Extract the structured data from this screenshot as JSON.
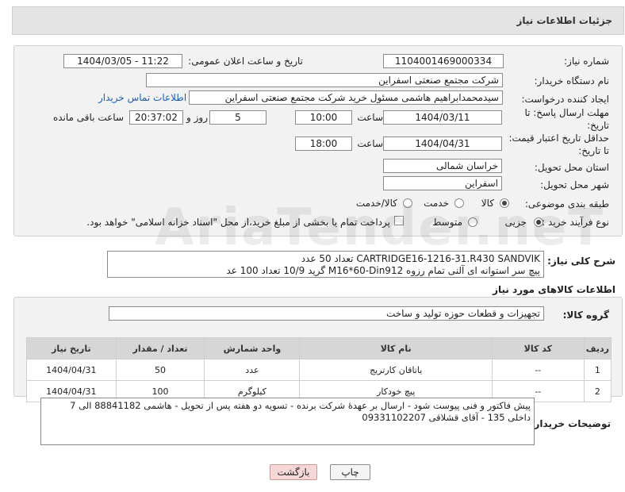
{
  "header": {
    "title": "جزئیات اطلاعات نیاز"
  },
  "form": {
    "need_number_label": "شماره نیاز:",
    "need_number": "1104001469000334",
    "announce_datetime_label": "تاریخ و ساعت اعلان عمومی:",
    "announce_datetime": "1404/03/05 - 11:22",
    "buyer_org_label": "نام دستگاه خریدار:",
    "buyer_org": "شرکت مجتمع صنعتی اسفراین",
    "requester_label": "ایجاد کننده درخواست:",
    "requester": "سیدمحمدابراهیم هاشمی مسئول خرید شرکت مجتمع صنعتی اسفراین",
    "contact_link": "اطلاعات تماس خریدار",
    "reply_deadline_label": "مهلت ارسال پاسخ: تا تاریخ:",
    "reply_deadline_line1": "مهلت ارسال پاسخ: تا",
    "reply_deadline_line2": "تاریخ:",
    "reply_date": "1404/03/11",
    "time_label": "ساعت",
    "reply_time": "10:00",
    "days_value": "5",
    "days_label": "روز و",
    "remaining_time": "20:37:02",
    "remaining_label": "ساعت باقی مانده",
    "price_valid_line1": "حداقل تاریخ اعتبار قیمت:",
    "price_valid_line2": "تا تاریخ:",
    "price_valid_date": "1404/04/31",
    "price_valid_time": "18:00",
    "province_label": "استان محل تحویل:",
    "province": "خراسان شمالی",
    "city_label": "شهر محل تحویل:",
    "city": "اسفراین",
    "category_label": "طبقه بندی موضوعی:",
    "category_options": [
      "کالا",
      "خدمت",
      "کالا/خدمت"
    ],
    "category_selected": "کالا",
    "process_label": "نوع فرآیند خرید :",
    "process_options": [
      "جزیی",
      "متوسط"
    ],
    "process_selected": "جزیی",
    "payment_note": "پرداخت تمام یا بخشی از مبلغ خرید،از محل \"اسناد خزانه اسلامی\" خواهد بود."
  },
  "description": {
    "label": "شرح کلی نیاز:",
    "line1": "CARTRIDGE16-1216-31.R430 SANDVIK تعداد 50 عدد",
    "line2": "پیچ سر استوانه ای آلنی تمام رزوه M16*60-Din912 گرید 10/9 تعداد 100 عد"
  },
  "goods": {
    "section_title": "اطلاعات کالاهای مورد نیاز",
    "group_label": "گروه کالا:",
    "group_value": "تجهیزات و قطعات حوزه تولید و ساخت",
    "columns": [
      "ردیف",
      "کد کالا",
      "نام کالا",
      "واحد شمارش",
      "تعداد / مقدار",
      "تاریخ نیاز"
    ],
    "rows": [
      {
        "row": "1",
        "code": "--",
        "name": "یاتاقان کارتریج",
        "unit": "عدد",
        "qty": "50",
        "date": "1404/04/31"
      },
      {
        "row": "2",
        "code": "--",
        "name": "پیچ خودکار",
        "unit": "کیلوگرم",
        "qty": "100",
        "date": "1404/04/31"
      }
    ]
  },
  "buyer_notes": {
    "label": "توضیحات خریدار:",
    "line1": "پیش فاکتور و فنی پیوست شود - ارسال بر عهدهٔ شرکت برنده - تسویه دو هفته پس از تحویل - هاشمی 88841182 الی 7",
    "line2": "داخلی 135 - آقای قشلاقی 09331102207"
  },
  "buttons": {
    "print": "چاپ",
    "back": "بازگشت"
  },
  "watermark": "AriaTender.neT"
}
